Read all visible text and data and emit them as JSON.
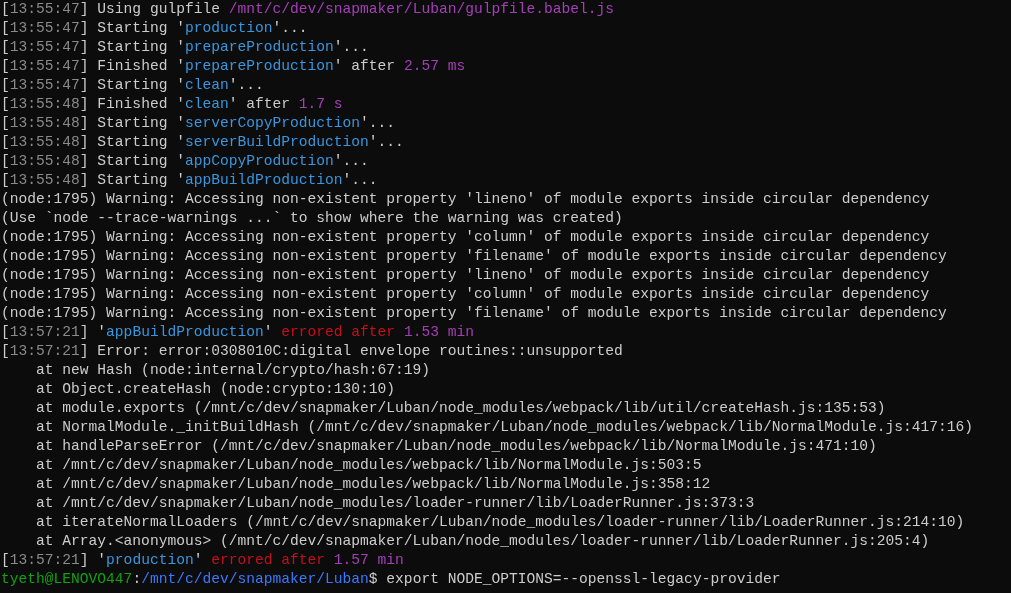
{
  "terminal": {
    "lines": [
      {
        "parts": [
          {
            "kind": "plain",
            "text": "["
          },
          {
            "kind": "time",
            "text": "13:55:47"
          },
          {
            "kind": "plain",
            "text": "] Using gulpfile "
          },
          {
            "kind": "number",
            "text": "/mnt/c/dev/snapmaker/Luban/gulpfile.babel.js"
          }
        ]
      },
      {
        "parts": [
          {
            "kind": "plain",
            "text": "["
          },
          {
            "kind": "time",
            "text": "13:55:47"
          },
          {
            "kind": "plain",
            "text": "] Starting '"
          },
          {
            "kind": "task",
            "text": "production"
          },
          {
            "kind": "plain",
            "text": "'..."
          }
        ]
      },
      {
        "parts": [
          {
            "kind": "plain",
            "text": "["
          },
          {
            "kind": "time",
            "text": "13:55:47"
          },
          {
            "kind": "plain",
            "text": "] Starting '"
          },
          {
            "kind": "task",
            "text": "prepareProduction"
          },
          {
            "kind": "plain",
            "text": "'..."
          }
        ]
      },
      {
        "parts": [
          {
            "kind": "plain",
            "text": "["
          },
          {
            "kind": "time",
            "text": "13:55:47"
          },
          {
            "kind": "plain",
            "text": "] Finished '"
          },
          {
            "kind": "task",
            "text": "prepareProduction"
          },
          {
            "kind": "plain",
            "text": "' after "
          },
          {
            "kind": "number",
            "text": "2.57 ms"
          }
        ]
      },
      {
        "parts": [
          {
            "kind": "plain",
            "text": "["
          },
          {
            "kind": "time",
            "text": "13:55:47"
          },
          {
            "kind": "plain",
            "text": "] Starting '"
          },
          {
            "kind": "task",
            "text": "clean"
          },
          {
            "kind": "plain",
            "text": "'..."
          }
        ]
      },
      {
        "parts": [
          {
            "kind": "plain",
            "text": "["
          },
          {
            "kind": "time",
            "text": "13:55:48"
          },
          {
            "kind": "plain",
            "text": "] Finished '"
          },
          {
            "kind": "task",
            "text": "clean"
          },
          {
            "kind": "plain",
            "text": "' after "
          },
          {
            "kind": "number",
            "text": "1.7 s"
          }
        ]
      },
      {
        "parts": [
          {
            "kind": "plain",
            "text": "["
          },
          {
            "kind": "time",
            "text": "13:55:48"
          },
          {
            "kind": "plain",
            "text": "] Starting '"
          },
          {
            "kind": "task",
            "text": "serverCopyProduction"
          },
          {
            "kind": "plain",
            "text": "'..."
          }
        ]
      },
      {
        "parts": [
          {
            "kind": "plain",
            "text": "["
          },
          {
            "kind": "time",
            "text": "13:55:48"
          },
          {
            "kind": "plain",
            "text": "] Starting '"
          },
          {
            "kind": "task",
            "text": "serverBuildProduction"
          },
          {
            "kind": "plain",
            "text": "'..."
          }
        ]
      },
      {
        "parts": [
          {
            "kind": "plain",
            "text": "["
          },
          {
            "kind": "time",
            "text": "13:55:48"
          },
          {
            "kind": "plain",
            "text": "] Starting '"
          },
          {
            "kind": "task",
            "text": "appCopyProduction"
          },
          {
            "kind": "plain",
            "text": "'..."
          }
        ]
      },
      {
        "parts": [
          {
            "kind": "plain",
            "text": "["
          },
          {
            "kind": "time",
            "text": "13:55:48"
          },
          {
            "kind": "plain",
            "text": "] Starting '"
          },
          {
            "kind": "task",
            "text": "appBuildProduction"
          },
          {
            "kind": "plain",
            "text": "'..."
          }
        ]
      },
      {
        "parts": [
          {
            "kind": "plain",
            "text": "(node:1795) Warning: Accessing non-existent property 'lineno' of module exports inside circular dependency"
          }
        ]
      },
      {
        "parts": [
          {
            "kind": "plain",
            "text": "(Use `node --trace-warnings ...` to show where the warning was created)"
          }
        ]
      },
      {
        "parts": [
          {
            "kind": "plain",
            "text": "(node:1795) Warning: Accessing non-existent property 'column' of module exports inside circular dependency"
          }
        ]
      },
      {
        "parts": [
          {
            "kind": "plain",
            "text": "(node:1795) Warning: Accessing non-existent property 'filename' of module exports inside circular dependency"
          }
        ]
      },
      {
        "parts": [
          {
            "kind": "plain",
            "text": "(node:1795) Warning: Accessing non-existent property 'lineno' of module exports inside circular dependency"
          }
        ]
      },
      {
        "parts": [
          {
            "kind": "plain",
            "text": "(node:1795) Warning: Accessing non-existent property 'column' of module exports inside circular dependency"
          }
        ]
      },
      {
        "parts": [
          {
            "kind": "plain",
            "text": "(node:1795) Warning: Accessing non-existent property 'filename' of module exports inside circular dependency"
          }
        ]
      },
      {
        "parts": [
          {
            "kind": "plain",
            "text": "["
          },
          {
            "kind": "time",
            "text": "13:57:21"
          },
          {
            "kind": "plain",
            "text": "] '"
          },
          {
            "kind": "task",
            "text": "appBuildProduction"
          },
          {
            "kind": "plain",
            "text": "' "
          },
          {
            "kind": "error",
            "text": "errored after "
          },
          {
            "kind": "number",
            "text": "1.53 min"
          }
        ]
      },
      {
        "parts": [
          {
            "kind": "plain",
            "text": "["
          },
          {
            "kind": "time",
            "text": "13:57:21"
          },
          {
            "kind": "plain",
            "text": "] Error: error:0308010C:digital envelope routines::unsupported"
          }
        ]
      },
      {
        "parts": [
          {
            "kind": "plain",
            "text": "    at new Hash (node:internal/crypto/hash:67:19)"
          }
        ]
      },
      {
        "parts": [
          {
            "kind": "plain",
            "text": "    at Object.createHash (node:crypto:130:10)"
          }
        ]
      },
      {
        "parts": [
          {
            "kind": "plain",
            "text": "    at module.exports (/mnt/c/dev/snapmaker/Luban/node_modules/webpack/lib/util/createHash.js:135:53)"
          }
        ]
      },
      {
        "parts": [
          {
            "kind": "plain",
            "text": "    at NormalModule._initBuildHash (/mnt/c/dev/snapmaker/Luban/node_modules/webpack/lib/NormalModule.js:417:16)"
          }
        ]
      },
      {
        "parts": [
          {
            "kind": "plain",
            "text": "    at handleParseError (/mnt/c/dev/snapmaker/Luban/node_modules/webpack/lib/NormalModule.js:471:10)"
          }
        ]
      },
      {
        "parts": [
          {
            "kind": "plain",
            "text": "    at /mnt/c/dev/snapmaker/Luban/node_modules/webpack/lib/NormalModule.js:503:5"
          }
        ]
      },
      {
        "parts": [
          {
            "kind": "plain",
            "text": "    at /mnt/c/dev/snapmaker/Luban/node_modules/webpack/lib/NormalModule.js:358:12"
          }
        ]
      },
      {
        "parts": [
          {
            "kind": "plain",
            "text": "    at /mnt/c/dev/snapmaker/Luban/node_modules/loader-runner/lib/LoaderRunner.js:373:3"
          }
        ]
      },
      {
        "parts": [
          {
            "kind": "plain",
            "text": "    at iterateNormalLoaders (/mnt/c/dev/snapmaker/Luban/node_modules/loader-runner/lib/LoaderRunner.js:214:10)"
          }
        ]
      },
      {
        "parts": [
          {
            "kind": "plain",
            "text": "    at Array.<anonymous> (/mnt/c/dev/snapmaker/Luban/node_modules/loader-runner/lib/LoaderRunner.js:205:4)"
          }
        ]
      },
      {
        "parts": [
          {
            "kind": "plain",
            "text": "["
          },
          {
            "kind": "time",
            "text": "13:57:21"
          },
          {
            "kind": "plain",
            "text": "] '"
          },
          {
            "kind": "task",
            "text": "production"
          },
          {
            "kind": "plain",
            "text": "' "
          },
          {
            "kind": "error",
            "text": "errored after "
          },
          {
            "kind": "number",
            "text": "1.57 min"
          }
        ]
      },
      {
        "parts": [
          {
            "kind": "user",
            "text": "tyeth@LENOVO447"
          },
          {
            "kind": "plain",
            "text": ":"
          },
          {
            "kind": "path",
            "text": "/mnt/c/dev/snapmaker/Luban"
          },
          {
            "kind": "plain",
            "text": "$ export NODE_OPTIONS=--openssl-legacy-provider"
          }
        ]
      }
    ]
  }
}
